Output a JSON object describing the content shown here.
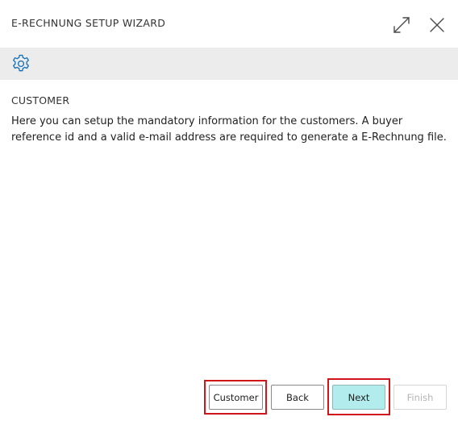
{
  "dialog": {
    "title": "E-RECHNUNG SETUP WIZARD"
  },
  "icons": {
    "expand": "expand-icon",
    "close": "close-icon",
    "settings": "gear-icon"
  },
  "content": {
    "heading": "CUSTOMER",
    "description": "Here you can setup the mandatory information for the customers. A buyer reference id and a valid e-mail address are required to generate a E-Rechnung file."
  },
  "buttons": {
    "customer": "Customer",
    "back": "Back",
    "next": "Next",
    "finish": "Finish"
  },
  "colors": {
    "accent": "#0f6cbd",
    "next_button_bg": "#b2ecec",
    "highlight_border": "#d0161b",
    "toolbar_bg": "#ececec"
  }
}
